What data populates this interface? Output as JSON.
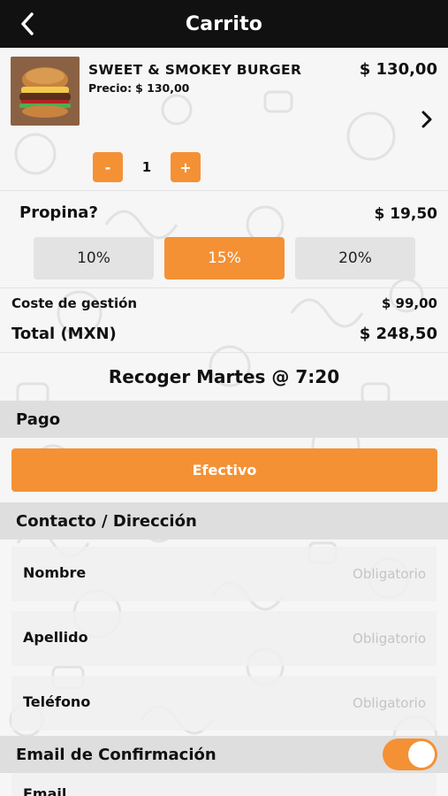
{
  "header": {
    "title": "Carrito"
  },
  "cart_item": {
    "name": "SWEET & SMOKEY BURGER",
    "price_label": "Precio:",
    "unit_price": "$ 130,00",
    "total": "$ 130,00",
    "quantity": "1",
    "minus_label": "-",
    "plus_label": "+"
  },
  "tip": {
    "label": "Propina?",
    "amount": "$ 19,50",
    "options": [
      "10%",
      "15%",
      "20%"
    ],
    "selected": "15%"
  },
  "fees": {
    "management_label": "Coste de gestión",
    "management_value": "$ 99,00",
    "total_label": "Total (MXN)",
    "total_value": "$ 248,50"
  },
  "pickup": {
    "text": "Recoger Martes @ 7:20"
  },
  "payment": {
    "section_title": "Pago",
    "method_label": "Efectivo"
  },
  "contact": {
    "section_title": "Contacto / Dirección",
    "fields": [
      {
        "label": "Nombre",
        "placeholder": "Obligatorio"
      },
      {
        "label": "Apellido",
        "placeholder": "Obligatorio"
      },
      {
        "label": "Teléfono",
        "placeholder": "Obligatorio"
      }
    ]
  },
  "email_confirmation": {
    "label": "Email de Confirmación",
    "enabled": true,
    "field_label": "Email"
  },
  "colors": {
    "accent": "#f49135",
    "header_bg": "#111111",
    "band_bg": "#dedede",
    "button_bg": "#e3e3e3"
  },
  "icons": {
    "back": "chevron-left-icon",
    "detail": "chevron-right-icon"
  }
}
